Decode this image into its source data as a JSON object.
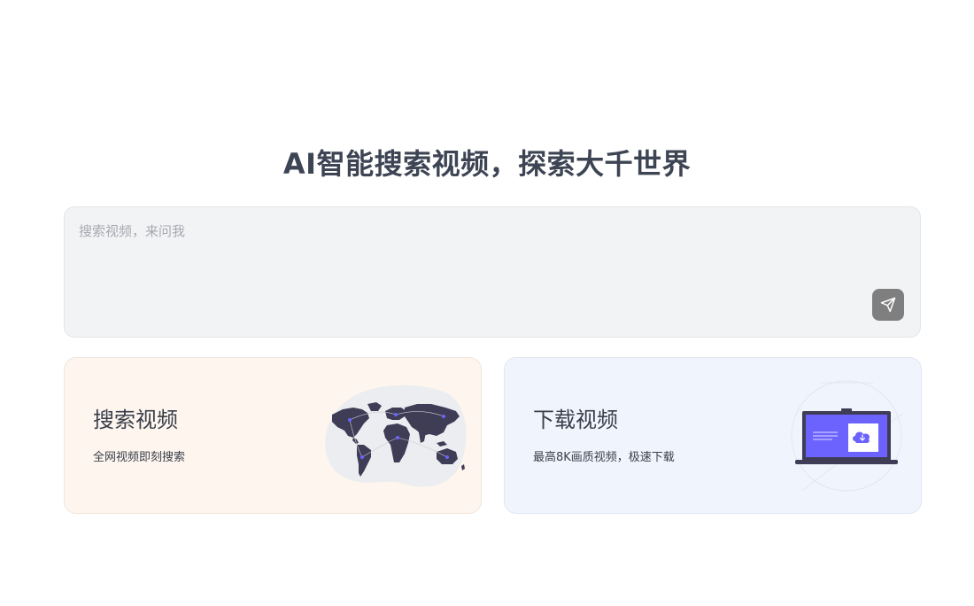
{
  "hero": {
    "title": "AI智能搜索视频，探索大千世界"
  },
  "search": {
    "placeholder": "搜索视频，来问我",
    "value": "",
    "send_icon": "send-icon"
  },
  "cards": {
    "search_video": {
      "title": "搜索视频",
      "description": "全网视频即刻搜索",
      "illustration": "world-map-icon"
    },
    "download_video": {
      "title": "下载视频",
      "description": "最高8K画质视频，极速下载",
      "illustration": "laptop-download-icon"
    }
  },
  "colors": {
    "title": "#3d4453",
    "search_bg": "#f2f3f5",
    "send_button": "#7f7f7f",
    "card_search_bg": "#fdf5ee",
    "card_download_bg": "#eff4fd",
    "accent_purple": "#6c63ff",
    "map_dark": "#3f3d56"
  }
}
